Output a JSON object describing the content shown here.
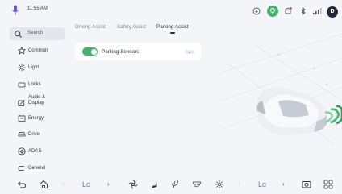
{
  "status_bar": {
    "time": "11:55 AM",
    "avatar_letter": "D",
    "icons": [
      "mic-icon",
      "download-icon",
      "location-icon",
      "notification-icon",
      "bluetooth-icon",
      "signal-icon"
    ]
  },
  "sidebar": {
    "search_label": "Search",
    "items": [
      {
        "label": "Common",
        "icon": "star-icon"
      },
      {
        "label": "Light",
        "icon": "sun-icon"
      },
      {
        "label": "Locks",
        "icon": "lock-icon"
      },
      {
        "label": "Audio &\nDisplay",
        "icon": "audio-display-icon"
      },
      {
        "label": "Energy",
        "icon": "battery-icon"
      },
      {
        "label": "Drive",
        "icon": "car-icon"
      },
      {
        "label": "ADAS",
        "icon": "steering-wheel-icon"
      },
      {
        "label": "General",
        "icon": "toggle-icon"
      }
    ]
  },
  "tabs": [
    "Driving Assist",
    "Safety Assist",
    "Parking Assist"
  ],
  "active_tab": "Parking Assist",
  "parking_sensors": {
    "label": "Parking Sensors",
    "enabled": true
  },
  "dock": {
    "left_temp": "Lo",
    "right_temp": "Lo",
    "icons": [
      "back-icon",
      "home-icon",
      "fan-icon",
      "seat-icon",
      "seat-heat-icon",
      "rear-defrost-icon",
      "ac-icon",
      "camera-icon",
      "apps-grid-icon"
    ]
  },
  "colors": {
    "accent_green": "#46b36d",
    "accent_blue": "#4a7ad6",
    "mic_purple": "#6b5bd6",
    "avatar_bg": "#232a3a"
  }
}
